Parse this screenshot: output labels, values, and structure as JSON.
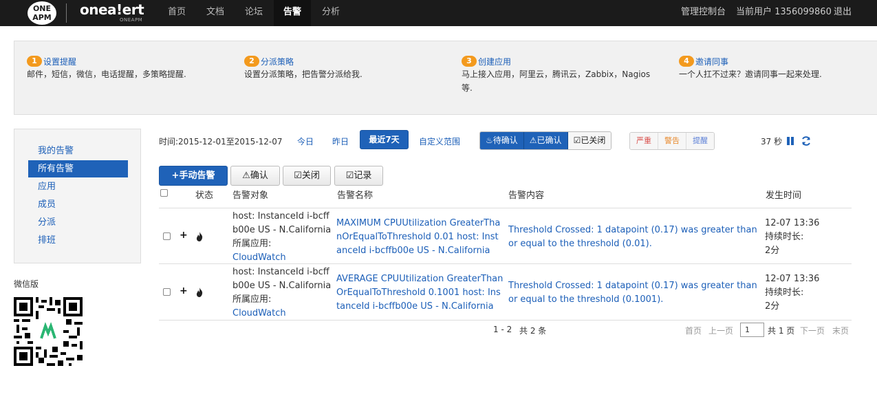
{
  "navbar": {
    "logo_oneapm_line1": "ONE",
    "logo_oneapm_line2": "APM",
    "logo_onealert": "onea!ert",
    "logo_onealert_sub": "ONEAPM",
    "items": [
      "首页",
      "文档",
      "论坛",
      "告警",
      "分析"
    ],
    "active_item": "告警",
    "admin": "管理控制台",
    "current_user": "当前用户 1356099860",
    "logout": "退出"
  },
  "steps": [
    {
      "num": "1",
      "title": "设置提醒",
      "desc": "邮件，短信，微信，电话提醒，多策略提醒."
    },
    {
      "num": "2",
      "title": "分派策略",
      "desc": "设置分派策略，把告警分派给我."
    },
    {
      "num": "3",
      "title": "创建应用",
      "desc": "马上接入应用，阿里云，腾讯云，Zabbix，Nagios",
      "desc2": "等."
    },
    {
      "num": "4",
      "title": "邀请同事",
      "desc": "一个人扛不过来？邀请同事一起来处理."
    }
  ],
  "sidebar": {
    "items": [
      "我的告警",
      "所有告警",
      "应用",
      "成员",
      "分派",
      "排班"
    ],
    "active": "所有告警",
    "wechat_label": "微信版"
  },
  "filter": {
    "time_range": "时间:2015-12-01至2015-12-07",
    "today": "今日",
    "yesterday": "昨日",
    "last7": "最近7天",
    "custom": "自定义范围",
    "status_pending": "待确认",
    "status_confirmed": "已确认",
    "status_closed": "已关闭",
    "sev_critical": "严重",
    "sev_warning": "警告",
    "sev_info": "提醒",
    "refresh_countdown": "37 秒"
  },
  "actions": {
    "manual_alert": "手动告警",
    "confirm": "确认",
    "close": "关闭",
    "log": "记录"
  },
  "table": {
    "headers": [
      "状态",
      "告警对象",
      "告警名称",
      "告警内容",
      "发生时间"
    ],
    "rows": [
      {
        "object_l1": "host: InstanceId i-bcff",
        "object_l2": "b00e US - N.California",
        "object_l3": "所属应用:",
        "object_app": "CloudWatch",
        "name_l1": "MAXIMUM CPUUtilization GreaterTha",
        "name_l2": "nOrEqualToThreshold 0.01 host: Inst",
        "name_l3": "anceId i-bcffb00e US - N.California",
        "content_l1": "Threshold Crossed: 1 datapoint (0.17) was greater than",
        "content_l2": "or equal to the threshold (0.01).",
        "time": "12-07 13:36",
        "duration_label": "持续时长:",
        "duration": "2分"
      },
      {
        "object_l1": "host: InstanceId i-bcff",
        "object_l2": "b00e US - N.California",
        "object_l3": "所属应用:",
        "object_app": "CloudWatch",
        "name_l1": "AVERAGE CPUUtilization GreaterThan",
        "name_l2": "OrEqualToThreshold 0.1001 host: Ins",
        "name_l3": "tanceId i-bcffb00e US - N.California",
        "content_l1": "Threshold Crossed: 1 datapoint (0.17) was greater than",
        "content_l2": "or equal to the threshold (0.1001).",
        "time": "12-07 13:36",
        "duration_label": "持续时长:",
        "duration": "2分"
      }
    ]
  },
  "pagination": {
    "range": "1 - 2",
    "total": "共 2 条",
    "first": "首页",
    "prev": "上一页",
    "current": "1",
    "of_pages": "共 1 页",
    "next": "下一页",
    "last": "末页"
  },
  "colors": {
    "accent": "#1f62b8",
    "link": "#1c5fb8",
    "step_badge": "#f39a1e",
    "critical": "#d9534f",
    "warning": "#f0ad4e",
    "info": "#5b7fd6"
  }
}
